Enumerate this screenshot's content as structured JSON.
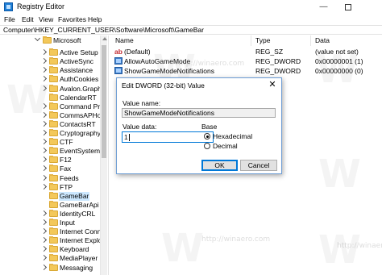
{
  "window": {
    "title": "Registry Editor",
    "minimize_glyph": "—",
    "icon": "registry-icon"
  },
  "menu": [
    "File",
    "Edit",
    "View",
    "Favorites",
    "Help"
  ],
  "address": "Computer\\HKEY_CURRENT_USER\\Software\\Microsoft\\GameBar",
  "tree": {
    "root": "Microsoft",
    "items": [
      "Active Setup",
      "ActiveSync",
      "Assistance",
      "AuthCookies",
      "Avalon.Graphi",
      "CalendarRT",
      "Command Pro",
      "CommsAPHos",
      "ContactsRT",
      "Cryptography",
      "CTF",
      "EventSystem",
      "F12",
      "Fax",
      "Feeds",
      "FTP",
      "GameBar",
      "GameBarApi",
      "IdentityCRL",
      "Input",
      "Internet Conne",
      "Internet Explor",
      "Keyboard",
      "MediaPlayer",
      "Messaging"
    ],
    "selected": "GameBar"
  },
  "values_pane": {
    "columns": [
      "Name",
      "Type",
      "Data"
    ],
    "rows": [
      {
        "icon": "string-value-icon",
        "name": "(Default)",
        "type": "REG_SZ",
        "data": "(value not set)"
      },
      {
        "icon": "dword-value-icon",
        "name": "AllowAutoGameMode",
        "type": "REG_DWORD",
        "data": "0x00000001 (1)"
      },
      {
        "icon": "dword-value-icon",
        "name": "ShowGameModeNotifications",
        "type": "REG_DWORD",
        "data": "0x00000000 (0)"
      }
    ]
  },
  "dialog": {
    "title": "Edit DWORD (32-bit) Value",
    "close_glyph": "✕",
    "value_name_label": "Value name:",
    "value_name": "ShowGameModeNotifications",
    "value_data_label": "Value data:",
    "value_data": "1",
    "base_label": "Base",
    "base_options": [
      "Hexadecimal",
      "Decimal"
    ],
    "base_selected": "Hexadecimal",
    "ok_label": "OK",
    "cancel_label": "Cancel"
  },
  "watermark": {
    "logo": "W",
    "text": "http://winaero.com"
  }
}
